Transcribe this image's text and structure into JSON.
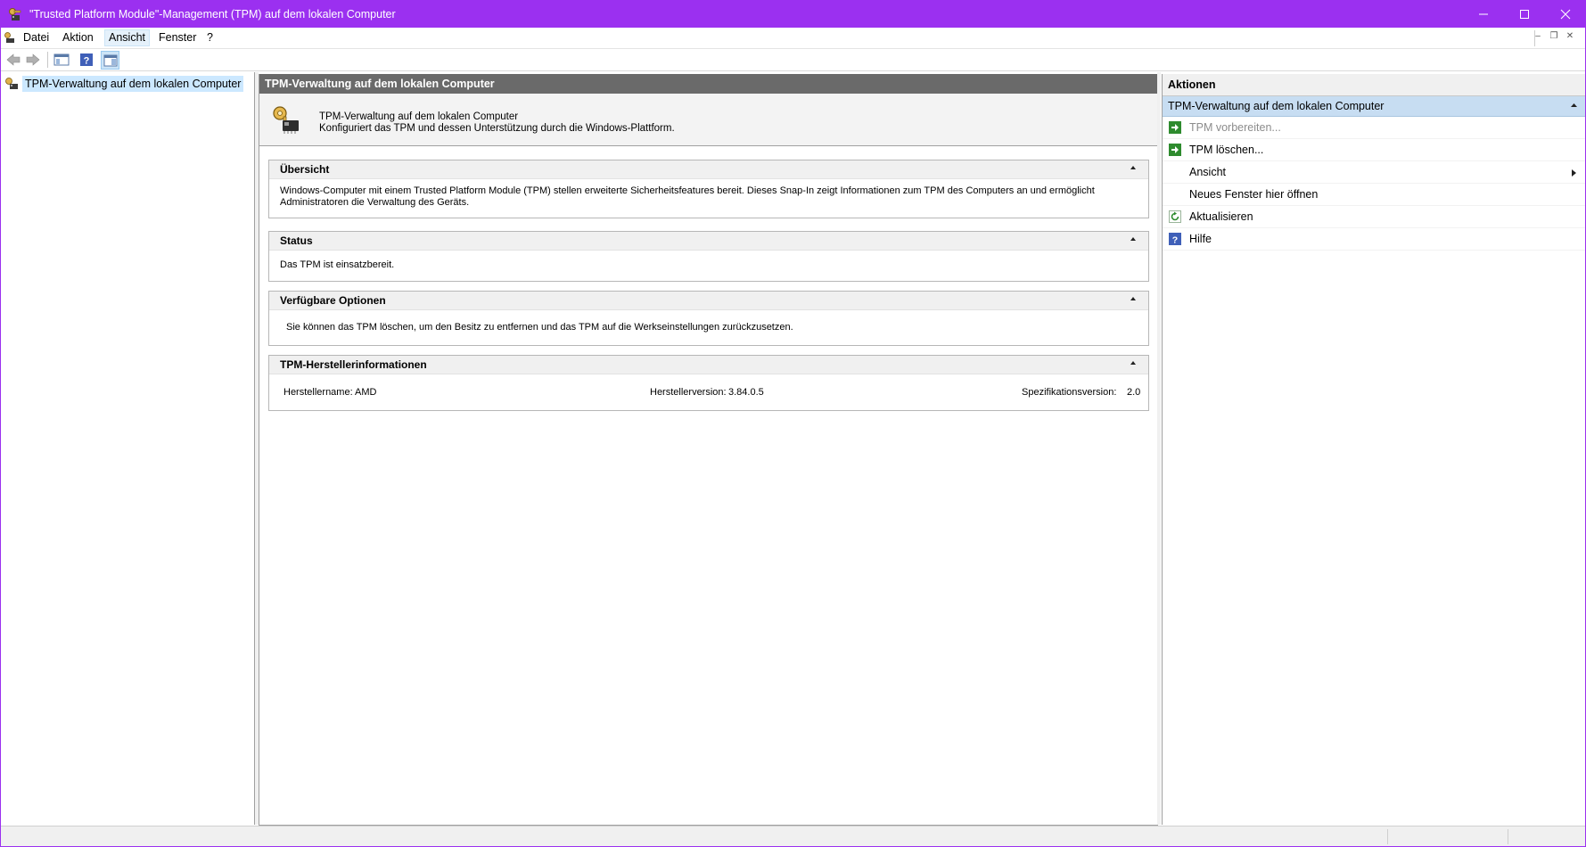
{
  "window": {
    "title": "\"Trusted Platform Module\"-Management (TPM) auf dem lokalen Computer",
    "accent": "#9b30f0"
  },
  "menu": {
    "items": [
      {
        "label": "Datei"
      },
      {
        "label": "Aktion"
      },
      {
        "label": "Ansicht"
      },
      {
        "label": "Fenster"
      },
      {
        "label": "?"
      }
    ]
  },
  "tree": {
    "root_label": "TPM-Verwaltung auf dem lokalen Computer"
  },
  "center": {
    "header": "TPM-Verwaltung auf dem lokalen Computer",
    "desc_title": "TPM-Verwaltung auf dem lokalen Computer",
    "desc_subtitle": "Konfiguriert das TPM und dessen Unterstützung durch die Windows-Plattform.",
    "overview": {
      "title": "Übersicht",
      "text": "Windows-Computer mit einem Trusted Platform Module (TPM) stellen erweiterte Sicherheitsfeatures bereit. Dieses Snap-In zeigt Informationen zum TPM des Computers an und ermöglicht Administratoren die Verwaltung des Geräts."
    },
    "status": {
      "title": "Status",
      "text": "Das TPM ist einsatzbereit."
    },
    "options": {
      "title": "Verfügbare Optionen",
      "text": "Sie können das TPM löschen, um den Besitz zu entfernen und das TPM auf die Werkseinstellungen zurückzusetzen."
    },
    "manufacturer": {
      "title": "TPM-Herstellerinformationen",
      "name_label": "Herstellername:",
      "name_value": "AMD",
      "version_label": "Herstellerversion:",
      "version_value": "3.84.0.5",
      "spec_label": "Spezifikationsversion:",
      "spec_value": "2.0"
    }
  },
  "actions": {
    "header": "Aktionen",
    "group_label": "TPM-Verwaltung auf dem lokalen Computer",
    "items": [
      {
        "label": "TPM vorbereiten...",
        "icon": "green-arrow-icon",
        "disabled": true
      },
      {
        "label": "TPM löschen...",
        "icon": "green-arrow-icon"
      },
      {
        "label": "Ansicht",
        "icon": "none",
        "submenu": true
      },
      {
        "label": "Neues Fenster hier öffnen",
        "icon": "none"
      },
      {
        "label": "Aktualisieren",
        "icon": "refresh-icon"
      },
      {
        "label": "Hilfe",
        "icon": "help-icon"
      }
    ]
  }
}
